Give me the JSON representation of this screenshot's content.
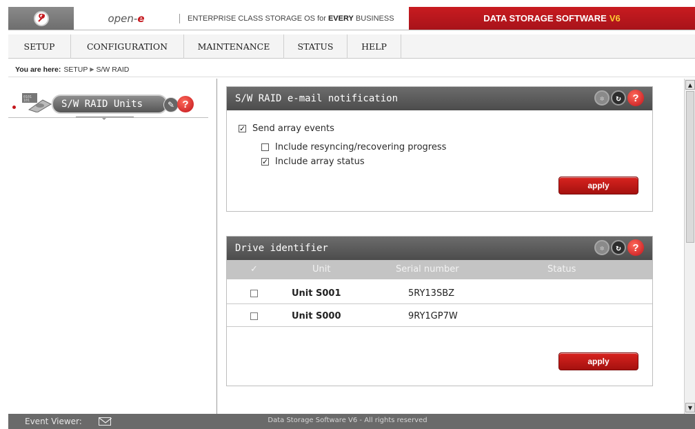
{
  "header": {
    "brand_text": "open-",
    "brand_e": "e",
    "tagline_prefix": "ENTERPRISE CLASS STORAGE OS for ",
    "tagline_bold": "EVERY",
    "tagline_suffix": " BUSINESS",
    "product_name": "DATA STORAGE SOFTWARE",
    "product_version": "V6"
  },
  "menu": {
    "items": [
      "SETUP",
      "CONFIGURATION",
      "MAINTENANCE",
      "STATUS",
      "HELP"
    ]
  },
  "breadcrumb": {
    "label": "You are here:",
    "path": [
      "SETUP",
      "S/W RAID"
    ]
  },
  "left_panel": {
    "title": "S/W RAID Units"
  },
  "email_panel": {
    "title": "S/W RAID e-mail notification",
    "options": [
      {
        "label": "Send array events",
        "checked": true
      },
      {
        "label": "Include resyncing/recovering progress",
        "checked": false
      },
      {
        "label": "Include array status",
        "checked": true
      }
    ],
    "apply_label": "apply"
  },
  "drive_panel": {
    "title": "Drive identifier",
    "columns": [
      "✓",
      "Unit",
      "Serial number",
      "Status"
    ],
    "rows": [
      {
        "unit": "Unit S001",
        "serial": "5RY13SBZ",
        "status": "",
        "checked": false
      },
      {
        "unit": "Unit S000",
        "serial": "9RY1GP7W",
        "status": "",
        "checked": false
      }
    ],
    "apply_label": "apply"
  },
  "footer": {
    "event_viewer": "Event Viewer:",
    "copyright": "Data Storage Software V6 - All rights reserved"
  },
  "colors": {
    "brand_red": "#c4161c",
    "header_gray": "#555555",
    "table_header": "#c4c4c4"
  }
}
